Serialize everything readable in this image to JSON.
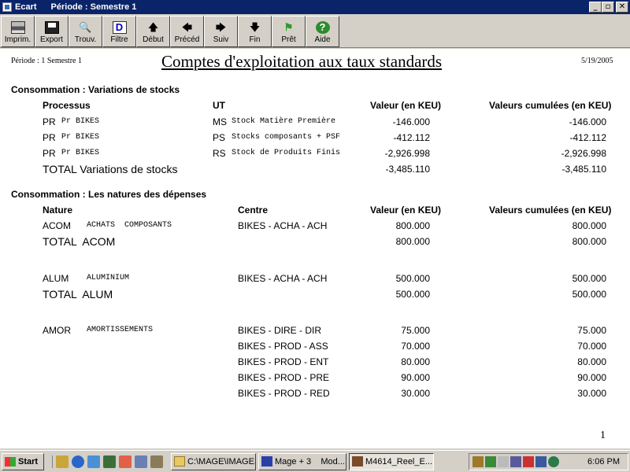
{
  "window": {
    "app": "Ecart",
    "title": "Période : Semestre 1",
    "controls": [
      "_",
      "▫",
      "✕"
    ]
  },
  "toolbar": [
    {
      "label": "Imprim.",
      "icon": "printer-icon"
    },
    {
      "label": "Export",
      "icon": "disk-icon"
    },
    {
      "label": "Trouv.",
      "icon": "find-icon"
    },
    {
      "label": "Filtre",
      "icon": "filter-icon"
    },
    {
      "label": "Début",
      "icon": "arrow-up-icon"
    },
    {
      "label": "Précéd",
      "icon": "arrow-left-icon"
    },
    {
      "label": "Suiv",
      "icon": "arrow-right-icon"
    },
    {
      "label": "Fin",
      "icon": "arrow-down-icon"
    },
    {
      "label": "Prêt",
      "icon": "flag-icon"
    },
    {
      "label": "Aide",
      "icon": "help-icon"
    }
  ],
  "report": {
    "period": "Période : 1  Semestre 1",
    "title": "Comptes d'exploitation aux taux standards",
    "date": "5/19/2005",
    "page_number": "1",
    "section1": {
      "title": "Consommation : Variations de stocks",
      "headers": {
        "col1": "Processus",
        "col2": "UT",
        "col3": "Valeur (en KEU)",
        "col4": "Valeurs cumulées (en KEU)"
      },
      "rows": [
        {
          "code": "PR",
          "desc": "Pr BIKES",
          "ut": "MS",
          "ut_desc": "Stock Matière Première",
          "value": "-146.000",
          "cumul": "-146.000"
        },
        {
          "code": "PR",
          "desc": "Pr BIKES",
          "ut": "PS",
          "ut_desc": "Stocks composants + PSF",
          "value": "-412.112",
          "cumul": "-412.112"
        },
        {
          "code": "PR",
          "desc": "Pr BIKES",
          "ut": "RS",
          "ut_desc": "Stock de Produits Finis",
          "value": "-2,926.998",
          "cumul": "-2,926.998"
        }
      ],
      "total": {
        "label": "TOTAL   Variations de stocks",
        "value": "-3,485.110",
        "cumul": "-3,485.110"
      }
    },
    "section2": {
      "title": "Consommation : Les natures des dépenses",
      "headers": {
        "col1": "Nature",
        "col2": "Centre",
        "col3": "Valeur (en KEU)",
        "col4": "Valeurs cumulées (en KEU)"
      },
      "acom": {
        "code": "ACOM",
        "desc": "ACHATS  COMPOSANTS",
        "rows": [
          {
            "centre": "BIKES - ACHA - ACH",
            "value": "800.000",
            "cumul": "800.000"
          }
        ],
        "total": {
          "label": "TOTAL  ACOM",
          "value": "800.000",
          "cumul": "800.000"
        }
      },
      "alum": {
        "code": "ALUM",
        "desc": "ALUMINIUM",
        "rows": [
          {
            "centre": "BIKES - ACHA - ACH",
            "value": "500.000",
            "cumul": "500.000"
          }
        ],
        "total": {
          "label": "TOTAL  ALUM",
          "value": "500.000",
          "cumul": "500.000"
        }
      },
      "amor": {
        "code": "AMOR",
        "desc": "AMORTISSEMENTS",
        "rows": [
          {
            "centre": "BIKES - DIRE - DIR",
            "value": "75.000",
            "cumul": "75.000"
          },
          {
            "centre": "BIKES - PROD - ASS",
            "value": "70.000",
            "cumul": "70.000"
          },
          {
            "centre": "BIKES - PROD - ENT",
            "value": "80.000",
            "cumul": "80.000"
          },
          {
            "centre": "BIKES - PROD - PRE",
            "value": "90.000",
            "cumul": "90.000"
          },
          {
            "centre": "BIKES - PROD - RED",
            "value": "30.000",
            "cumul": "30.000"
          }
        ]
      }
    }
  },
  "taskbar": {
    "start": "Start",
    "tasks": [
      "C:\\MAGE\\IMAGES",
      "Mage + 3    Mod...",
      "M4614_Reel_E..."
    ],
    "clock": "6:06 PM"
  }
}
